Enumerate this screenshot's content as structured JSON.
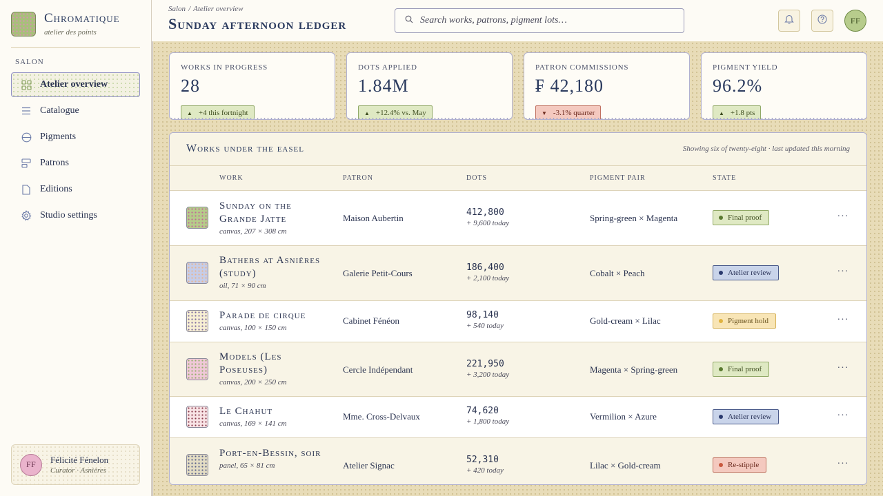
{
  "brand": {
    "name": "Chromatique",
    "tagline": "atelier des points"
  },
  "sidebar": {
    "section": "SALON",
    "items": [
      {
        "label": "Atelier overview",
        "icon": "grid-icon",
        "active": true
      },
      {
        "label": "Catalogue",
        "icon": "list-icon"
      },
      {
        "label": "Pigments",
        "icon": "palette-icon"
      },
      {
        "label": "Patrons",
        "icon": "patrons-icon"
      },
      {
        "label": "Editions",
        "icon": "document-icon"
      },
      {
        "label": "Studio settings",
        "icon": "gear-icon"
      }
    ],
    "user": {
      "initials": "FF",
      "name": "Félicité Fénelon",
      "role": "Curator · Asnières"
    }
  },
  "header": {
    "breadcrumb": [
      "Salon",
      "Atelier overview"
    ],
    "breadcrumb_sep": "/",
    "title": "Sunday afternoon ledger",
    "search_placeholder": "Search works, patrons, pigment lots…",
    "avatar_initials": "FF"
  },
  "kpis": [
    {
      "label": "WORKS IN PROGRESS",
      "value": "28",
      "delta": "+4 this fortnight",
      "trend": "up"
    },
    {
      "label": "DOTS APPLIED",
      "value": "1.84M",
      "delta": "+12.4% vs. May",
      "trend": "up"
    },
    {
      "label": "PATRON COMMISSIONS",
      "value": "₣ 42,180",
      "delta": "-3.1% quarter",
      "trend": "down"
    },
    {
      "label": "PIGMENT YIELD",
      "value": "96.2%",
      "delta": "+1.8 pts",
      "trend": "up"
    }
  ],
  "table": {
    "title": "Works under the easel",
    "meta": "Showing six of twenty-eight · last updated this morning",
    "columns": [
      "WORK",
      "PATRON",
      "DOTS",
      "PIGMENT PAIR",
      "STATE"
    ],
    "more_label": "···",
    "rows": [
      {
        "name": "Sunday on the Grande Jatte",
        "medium": "canvas, 207 × 308 cm",
        "patron": "Maison Aubertin",
        "dots": "412,800",
        "today": "+ 9,600 today",
        "pair": "Spring-green × Magenta",
        "state": "Final proof",
        "state_kind": "final",
        "swatch": [
          "#b5cc8a",
          "#c2679a"
        ]
      },
      {
        "name": "Bathers at Asnières (study)",
        "medium": "oil, 71 × 90 cm",
        "patron": "Galerie Petit-Cours",
        "dots": "186,400",
        "today": "+ 2,100 today",
        "pair": "Cobalt × Peach",
        "state": "Atelier review",
        "state_kind": "review",
        "swatch": [
          "#c6cde8",
          "#e8b48f"
        ]
      },
      {
        "name": "Parade de cirque",
        "medium": "canvas, 100 × 150 cm",
        "patron": "Cabinet Fénéon",
        "dots": "98,140",
        "today": "+ 540 today",
        "pair": "Gold-cream × Lilac",
        "state": "Pigment hold",
        "state_kind": "hold",
        "swatch": [
          "#f7efd3",
          "#7c6aa0"
        ]
      },
      {
        "name": "Models (Les Poseuses)",
        "medium": "canvas, 200 × 250 cm",
        "patron": "Cercle Indépendant",
        "dots": "221,950",
        "today": "+ 3,200 today",
        "pair": "Magenta × Spring-green",
        "state": "Final proof",
        "state_kind": "final",
        "swatch": [
          "#f0c8d8",
          "#93b06a"
        ]
      },
      {
        "name": "Le Chahut",
        "medium": "canvas, 169 × 141 cm",
        "patron": "Mme. Cross-Delvaux",
        "dots": "74,620",
        "today": "+ 1,800 today",
        "pair": "Vermilion × Azure",
        "state": "Atelier review",
        "state_kind": "review",
        "swatch": [
          "#f8e3e5",
          "#8a3c4c"
        ]
      },
      {
        "name": "Port-en-Bessin, soir",
        "medium": "panel, 65 × 81 cm",
        "patron": "Atelier Signac",
        "dots": "52,310",
        "today": "+ 420 today",
        "pair": "Lilac × Gold-cream",
        "state": "Re-stipple",
        "state_kind": "restipple",
        "swatch": [
          "#e3dcc3",
          "#58608c"
        ]
      }
    ]
  }
}
